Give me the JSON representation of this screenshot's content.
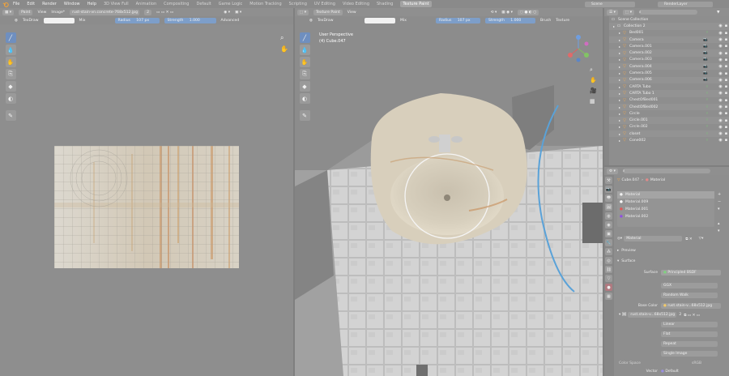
{
  "topbar": {
    "menus": [
      "File",
      "Edit",
      "Render",
      "Window",
      "Help"
    ],
    "workspaces": [
      "3D View Full",
      "Animation",
      "Compositing",
      "Default",
      "Game Logic",
      "Motion Tracking",
      "Scripting",
      "UV Editing",
      "Video Editing",
      "Shading",
      "Texture Paint"
    ],
    "active_workspace": "Texture Paint",
    "scene": "Scene",
    "view_layer": "RenderLayer"
  },
  "image_editor": {
    "mode": "Paint",
    "menus": [
      "View",
      "Image*"
    ],
    "image_name": "rust-stain-vn.concrete-768x512.jpg",
    "users": "2",
    "brush_name": "TexDraw",
    "blend": "Mix",
    "radius_label": "Radius",
    "radius_value": "107 px",
    "strength_label": "Strength",
    "strength_value": "1.000",
    "advanced": "Advanced"
  },
  "viewport": {
    "mode": "Texture Paint",
    "menu": "View",
    "brush_name": "TexDraw",
    "blend": "Mix",
    "radius_label": "Radius",
    "radius_value": "107 px",
    "strength_label": "Strength",
    "strength_value": "1.000",
    "brush_menu": "Brush",
    "texture_menu": "Texture",
    "overlay_title": "User Perspective",
    "overlay_object": "(4) Cube.047"
  },
  "outliner": {
    "search_placeholder": "",
    "items": [
      {
        "label": "Scene Collection",
        "type": "collection",
        "indent": 0
      },
      {
        "label": "Collection 2",
        "type": "collection",
        "indent": 1
      },
      {
        "label": "Bed001",
        "type": "mesh",
        "indent": 2
      },
      {
        "label": "Camera",
        "type": "camera",
        "indent": 2
      },
      {
        "label": "Camera.001",
        "type": "camera",
        "indent": 2
      },
      {
        "label": "Camera.002",
        "type": "camera",
        "indent": 2
      },
      {
        "label": "Camera.003",
        "type": "camera",
        "indent": 2
      },
      {
        "label": "Camera.004",
        "type": "camera",
        "indent": 2
      },
      {
        "label": "Camera.005",
        "type": "camera",
        "indent": 2
      },
      {
        "label": "Camera.006",
        "type": "camera",
        "indent": 2
      },
      {
        "label": "CARTA Tubo",
        "type": "mesh",
        "indent": 2
      },
      {
        "label": "CARTA Tubo 1",
        "type": "mesh",
        "indent": 2
      },
      {
        "label": "ChestOfBed001",
        "type": "mesh",
        "indent": 2
      },
      {
        "label": "ChestOfBed002",
        "type": "mesh",
        "indent": 2
      },
      {
        "label": "Circle",
        "type": "mesh",
        "indent": 2
      },
      {
        "label": "Circle.001",
        "type": "mesh",
        "indent": 2
      },
      {
        "label": "Circle.002",
        "type": "mesh",
        "indent": 2
      },
      {
        "label": "closet",
        "type": "mesh",
        "indent": 2
      },
      {
        "label": "Cone002",
        "type": "mesh",
        "indent": 2
      }
    ]
  },
  "properties": {
    "breadcrumb_object": "Cube.047",
    "breadcrumb_material": "Material",
    "slots": [
      "Material",
      "Material.009",
      "Material.001",
      "Material.002"
    ],
    "material_name": "Material",
    "preview_label": "Preview",
    "surface_label": "Surface",
    "surface_key": "Surface",
    "surface_value": "Principled BSDF",
    "ggx": "GGX",
    "random_walk": "Random Walk",
    "base_color_key": "Base Color",
    "base_color_value": "rust.stain-v...68x512.jpg",
    "image_value": "rust.stain-v...68x512.jpg",
    "image_users": "2",
    "interp": "Linear",
    "projection": "Flat",
    "extension": "Repeat",
    "source": "Single Image",
    "color_space_key": "Color Space",
    "color_space_value": "sRGB",
    "vector_key": "Vector",
    "vector_value": "Default"
  },
  "colors": {
    "accent": "#6f8fbf",
    "camera_icon": "#7cc77a",
    "mesh_icon": "#f3a84e"
  }
}
